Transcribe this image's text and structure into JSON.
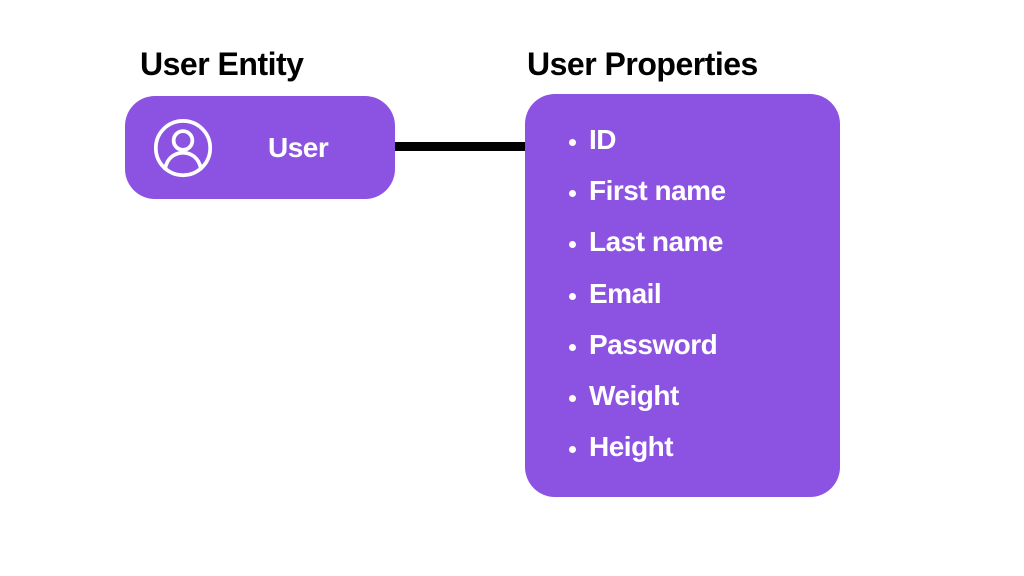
{
  "entity": {
    "heading": "User Entity",
    "label": "User"
  },
  "properties": {
    "heading": "User Properties",
    "items": [
      "ID",
      "First name",
      "Last name",
      "Email",
      "Password",
      "Weight",
      "Height"
    ]
  },
  "colors": {
    "box": "#8c52e1",
    "text_on_box": "#ffffff",
    "heading": "#000000",
    "connector": "#000000"
  }
}
